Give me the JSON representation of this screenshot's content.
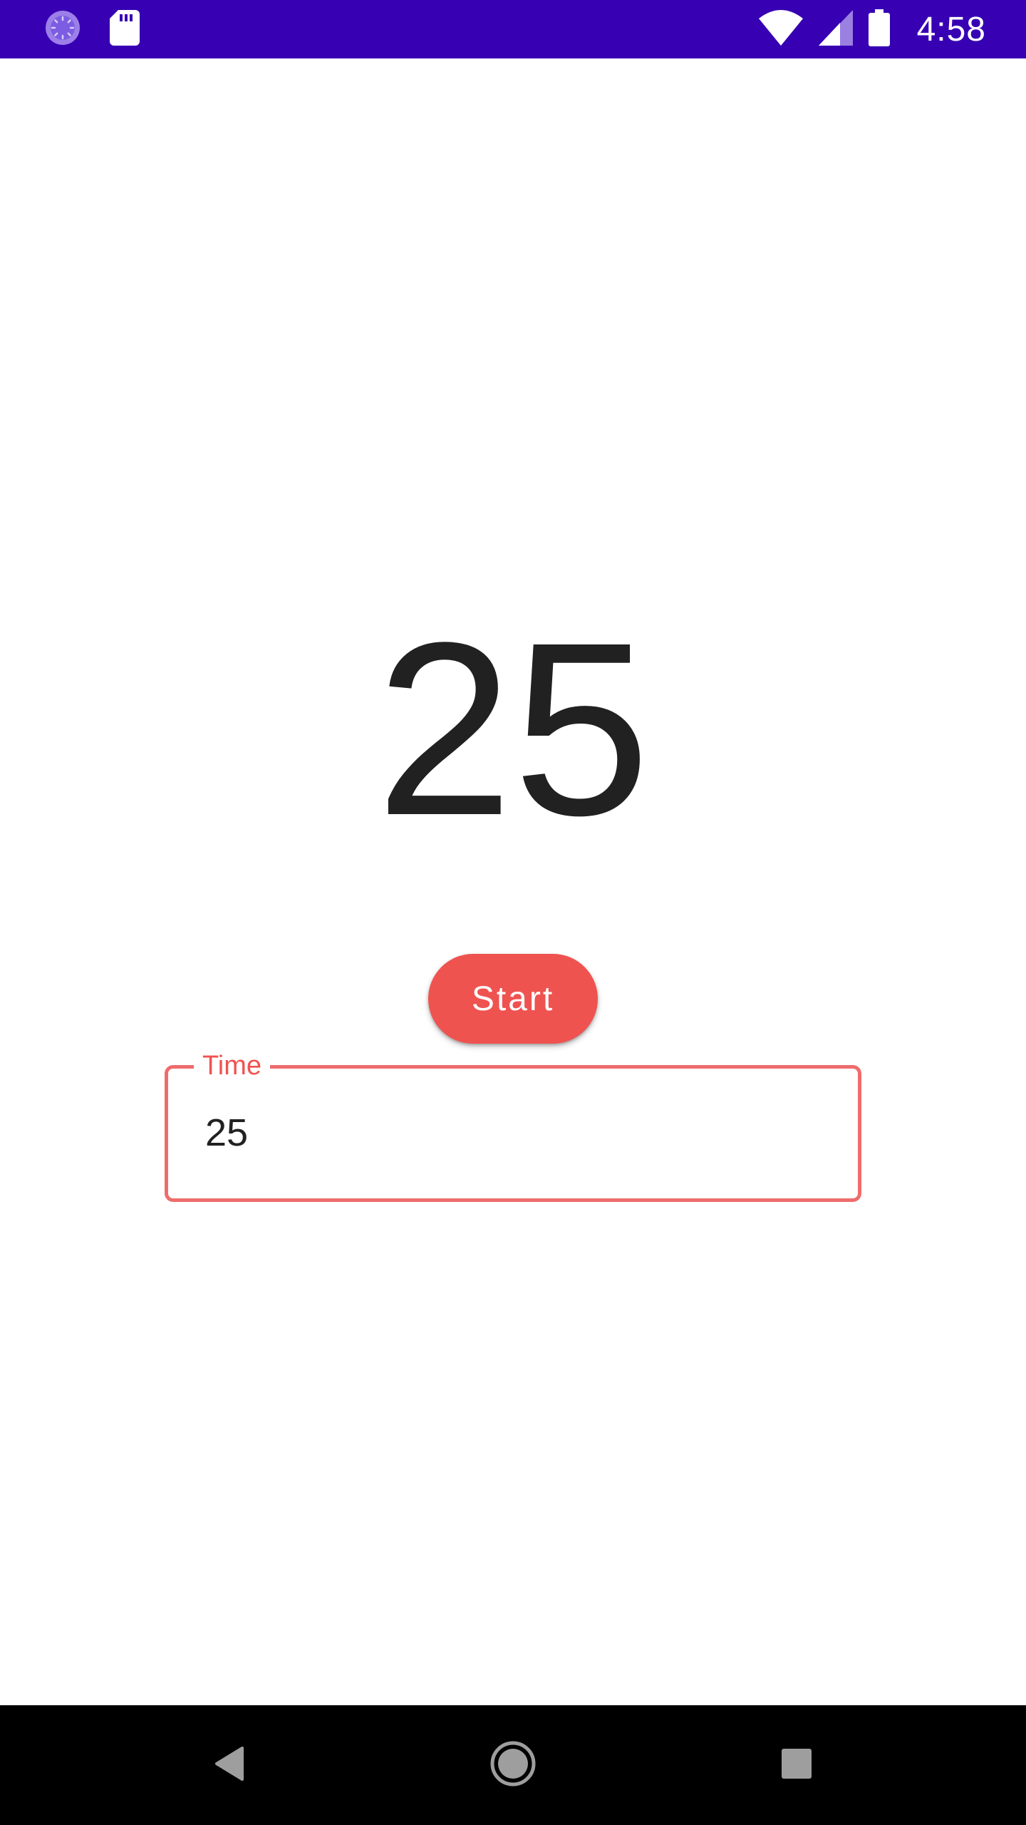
{
  "status_bar": {
    "background_color": "#3700b3",
    "time": "4:58",
    "left_icons": [
      "sync-spinner-icon",
      "sd-card-icon"
    ],
    "right_icons": [
      "wifi-icon",
      "cellular-signal-icon",
      "battery-icon"
    ]
  },
  "timer": {
    "value": "25"
  },
  "start_button": {
    "label": "Start",
    "color": "#ef5350"
  },
  "time_field": {
    "label": "Time",
    "value": "25",
    "border_color": "#ef6c6c"
  },
  "nav_bar": {
    "icons": [
      "back-icon",
      "home-icon",
      "recents-icon"
    ]
  }
}
